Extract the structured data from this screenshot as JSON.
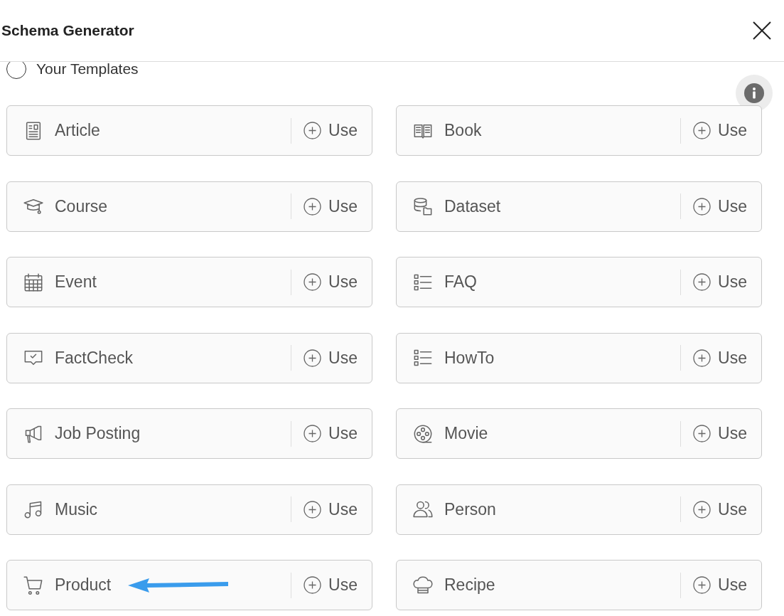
{
  "dialog": {
    "title": "Schema Generator"
  },
  "template_source": {
    "label": "Your Templates",
    "selected": false
  },
  "templates": [
    {
      "name": "Article",
      "action": "Use",
      "pointed_at": false
    },
    {
      "name": "Book",
      "action": "Use",
      "pointed_at": false
    },
    {
      "name": "Course",
      "action": "Use",
      "pointed_at": false
    },
    {
      "name": "Dataset",
      "action": "Use",
      "pointed_at": false
    },
    {
      "name": "Event",
      "action": "Use",
      "pointed_at": false
    },
    {
      "name": "FAQ",
      "action": "Use",
      "pointed_at": false
    },
    {
      "name": "FactCheck",
      "action": "Use",
      "pointed_at": false
    },
    {
      "name": "HowTo",
      "action": "Use",
      "pointed_at": false
    },
    {
      "name": "Job Posting",
      "action": "Use",
      "pointed_at": false
    },
    {
      "name": "Movie",
      "action": "Use",
      "pointed_at": false
    },
    {
      "name": "Music",
      "action": "Use",
      "pointed_at": false
    },
    {
      "name": "Person",
      "action": "Use",
      "pointed_at": false
    },
    {
      "name": "Product",
      "action": "Use",
      "pointed_at": true
    },
    {
      "name": "Recipe",
      "action": "Use",
      "pointed_at": false
    }
  ]
}
